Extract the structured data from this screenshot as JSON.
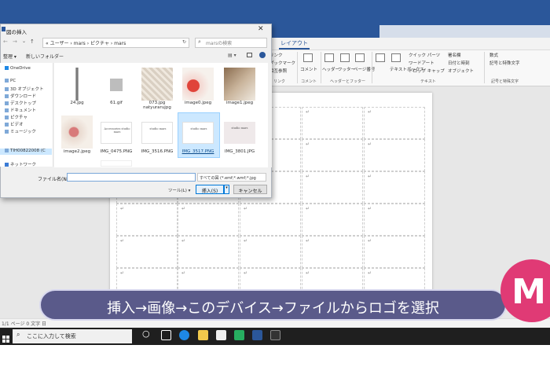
{
  "dialog": {
    "title": "図の挿入",
    "breadcrumb": "« ユーザー › mars › ピクチャ › mars",
    "search_placeholder": "marsの検索",
    "organize_label": "整理 ▾",
    "new_folder_label": "新しいフォルダー",
    "nav_items": [
      {
        "label": "OneDrive",
        "icon": "cloud-icon"
      },
      {
        "label": "PC",
        "icon": "pc-icon"
      },
      {
        "label": "3D オブジェクト",
        "icon": "cube-icon"
      },
      {
        "label": "ダウンロード",
        "icon": "download-icon"
      },
      {
        "label": "デスクトップ",
        "icon": "desktop-icon"
      },
      {
        "label": "ドキュメント",
        "icon": "document-icon"
      },
      {
        "label": "ピクチャ",
        "icon": "picture-icon"
      },
      {
        "label": "ビデオ",
        "icon": "video-icon"
      },
      {
        "label": "ミュージック",
        "icon": "music-icon"
      },
      {
        "label": "TIH00822008 (C",
        "icon": "drive-icon"
      },
      {
        "label": "ネットワーク",
        "icon": "network-icon"
      }
    ],
    "files": [
      {
        "name": "24.jpg"
      },
      {
        "name": "61.gif"
      },
      {
        "name": "073.jpg\nnatyurarujpg"
      },
      {
        "name": "image0.jpeg"
      },
      {
        "name": "image1.jpeg"
      },
      {
        "name": "image2.jpeg"
      },
      {
        "name": "IMG_0475.PNG"
      },
      {
        "name": "IMG_3516.PNG"
      },
      {
        "name": "IMG_3517.PNG"
      },
      {
        "name": "IMG_3801.JPG"
      }
    ],
    "thumb_texts": {
      "img0475": "Accessories studio mars",
      "img3516": "studio mars",
      "img3517": "studio mars",
      "img3801": "studio mars"
    },
    "filename_label": "ファイル名(N):",
    "filename_value": "",
    "filetype_value": "すべての図 (*.emf;*.wmf;*.jpg",
    "tools_label": "ツール(L) ▾",
    "insert_label": "挿入(S)",
    "cancel_label": "キャンセル",
    "selected_file": "IMG_3517.PNG"
  },
  "ribbon": {
    "active_tab": "レイアウト",
    "buttons": [
      "リンク",
      "ブックマーク",
      "相互参照",
      "コメント",
      "ヘッダー",
      "フッター",
      "ページ番号",
      "テキストボックス",
      "クイック パーツ",
      "ワードアート",
      "ドロップ キャップ",
      "署名欄",
      "日付と時刻",
      "オブジェクト",
      "数式",
      "記号と特殊文字"
    ],
    "groups": [
      "リンク",
      "コメント",
      "ヘッダーとフッター",
      "テキスト",
      "記号と特殊文字"
    ]
  },
  "status": {
    "text": "1/1 ページ  0 文字  日"
  },
  "taskbar": {
    "search_text": "ここに入力して検索"
  },
  "caption": {
    "text": "挿入→画像→このデバイス→ファイルからロゴを選択"
  },
  "logo": {
    "letter": "M"
  },
  "colors": {
    "word_blue": "#2b579a",
    "caption_bg": "#5a5a8a",
    "logo_pink": "#e03a75",
    "selection": "#cce8ff"
  }
}
